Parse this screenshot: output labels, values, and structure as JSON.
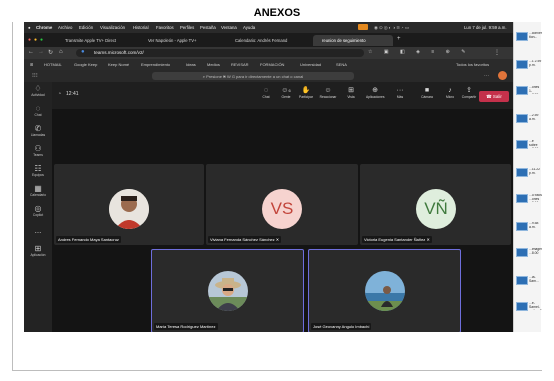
{
  "document": {
    "heading": "ANEXOS"
  },
  "menubar": {
    "app": "Chrome",
    "menus": [
      "Archivo",
      "Edición",
      "Visualización",
      "Historial",
      "Favoritos",
      "Perfiles",
      "Pestaña",
      "Ventana",
      "Ayuda"
    ],
    "clock": "Lun 7 de jul. 9:59 a.m."
  },
  "browser": {
    "tabs": [
      {
        "label": "Transmite Apple TV+ Direct"
      },
      {
        "label": "Ver Napoleón - Apple TV+"
      },
      {
        "label": "Calendario: Andrés Fernand"
      },
      {
        "label": "reunion de seguimiento"
      }
    ],
    "url": "teams.microsoft.com/v2/",
    "bookmarks": [
      "HOTMAIL",
      "Google Keep",
      "Keep Nomé",
      "Emprendimiento",
      "Ideas",
      "Medios",
      "REVISAR",
      "FORMACIÓN",
      "Universidad",
      "SENA",
      "Todos los favoritos"
    ]
  },
  "teams": {
    "search_placeholder": "Presione ⌘ W G para ir directamente a un chat o canal",
    "rail": [
      {
        "label": "Actividad",
        "icon": "bell-icon"
      },
      {
        "label": "Chat",
        "icon": "chat-icon"
      },
      {
        "label": "Llamadas",
        "icon": "phone-icon"
      },
      {
        "label": "Teams",
        "icon": "teams-icon"
      },
      {
        "label": "Equipos",
        "icon": "group-icon"
      },
      {
        "label": "Calendario",
        "icon": "calendar-icon"
      },
      {
        "label": "Copilot",
        "icon": "copilot-icon"
      },
      {
        "label": "...",
        "icon": "more-icon"
      },
      {
        "label": "Aplicación",
        "icon": "apps-icon"
      }
    ]
  },
  "meeting": {
    "timer": "12:41",
    "controls": [
      {
        "label": "Chat",
        "icon": "chat-icon"
      },
      {
        "label": "Gente",
        "icon": "people-icon",
        "badge": "6"
      },
      {
        "label": "Participar",
        "icon": "raise-hand-icon"
      },
      {
        "label": "Reaccionar",
        "icon": "react-icon"
      },
      {
        "label": "Vista",
        "icon": "view-icon"
      },
      {
        "label": "Aplicaciones",
        "icon": "apps-icon"
      },
      {
        "label": "Más",
        "icon": "more-icon"
      },
      {
        "label": "Cámara",
        "icon": "camera-icon"
      },
      {
        "label": "Micro",
        "icon": "mic-icon"
      },
      {
        "label": "Compartir",
        "icon": "share-icon"
      }
    ],
    "leave_label": "Salir",
    "participants": [
      {
        "name": "Andres Fernando Maya Santacruz",
        "avatar": "photo"
      },
      {
        "name": "Viviana Fernanda Sánchez Sánchez",
        "initials": "VS"
      },
      {
        "name": "Victoria Eugenia Santander Ñañez",
        "initials": "VÑ"
      },
      {
        "name": "María Teresa Rodríguez Martínez",
        "avatar": "photo"
      },
      {
        "name": "José Geovanny Angulo Imbachí",
        "avatar": "photo"
      }
    ],
    "colors": {
      "vs_bg": "#f6d3cf",
      "vs_fg": "#c2443a",
      "vn_bg": "#dfeedd",
      "vn_fg": "#3f7a3d",
      "leave": "#c4314b"
    }
  },
  "desktop_thumbs": [
    "...conversa- tion...",
    "...1 2.59 p.m.",
    "...ones 1- ...7.59 a.m.",
    "...2.59 a.m.",
    "...e sobre ...7.00 p.m.",
    "...11.22 p.m.",
    "...u fotos ...ones ...8.10 a.m.",
    "...9.58 a.m.",
    "...imágenes ...8.00 a.m.",
    "...la-Sam...",
    "...e-Samel- ...vila...8.19 p.m."
  ]
}
